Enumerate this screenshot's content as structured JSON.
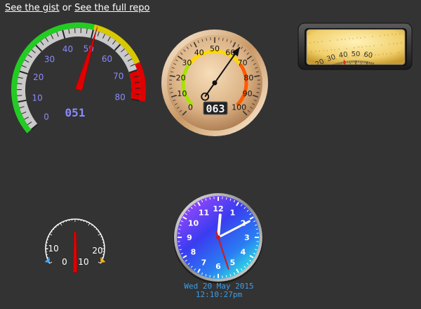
{
  "links": {
    "gist_label": "See the gist",
    "separator": " or ",
    "repo_label": "See the full repo"
  },
  "speed_gauge": {
    "ticks": [
      "0",
      "10",
      "20",
      "30",
      "40",
      "50",
      "60",
      "70",
      "80"
    ],
    "value": 51,
    "readout": "051",
    "zones": {
      "green": "#22cc22",
      "yellow": "#d8c800",
      "red": "#e00000"
    }
  },
  "round_gauge": {
    "ticks": [
      "0",
      "10",
      "20",
      "30",
      "40",
      "50",
      "60",
      "70",
      "80",
      "90",
      "100"
    ],
    "value": 63,
    "readout": "063"
  },
  "linear_gauge": {
    "ticks": [
      "20",
      "30",
      "40",
      "50",
      "60"
    ],
    "value": 40
  },
  "mini_gauge": {
    "ticks": [
      "-10",
      "0",
      "10",
      "20"
    ],
    "value": 4,
    "cold_color": "#44aaff",
    "hot_color": "#ffb000"
  },
  "clock": {
    "numbers": [
      "12",
      "1",
      "2",
      "3",
      "4",
      "5",
      "6",
      "7",
      "8",
      "9",
      "10",
      "11"
    ],
    "time": {
      "hours": 12,
      "minutes": 10,
      "seconds": 27
    },
    "date": "Wed 20 May 2015",
    "time_text": "12:10:27pm"
  }
}
